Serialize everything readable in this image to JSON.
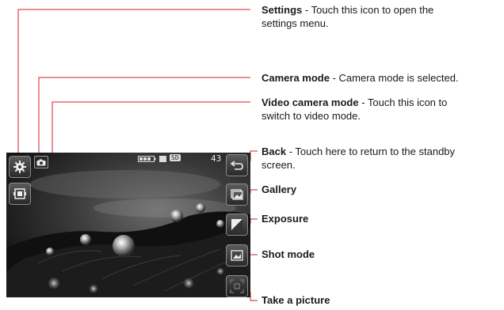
{
  "annotations": {
    "settings": {
      "title": "Settings",
      "desc": "Touch this icon to open the",
      "desc2": "settings menu."
    },
    "camera_mode": {
      "title": "Camera mode",
      "desc": "Camera mode is selected."
    },
    "video_mode": {
      "title": "Video camera mode",
      "desc": "Touch this icon to",
      "desc2": "switch to video mode."
    },
    "back": {
      "title": "Back",
      "desc": "Touch here to return to the standby",
      "desc2": "screen."
    },
    "gallery": {
      "title": "Gallery"
    },
    "exposure": {
      "title": "Exposure"
    },
    "shot_mode": {
      "title": "Shot mode"
    },
    "take_picture": {
      "title": "Take a picture"
    }
  },
  "separator": " - ",
  "screen": {
    "shot_count": "43",
    "storage_badge": "SD"
  },
  "icons": [
    "gear-icon",
    "camera-icon",
    "video-camera-icon",
    "back-arrow-icon",
    "gallery-icon",
    "exposure-icon",
    "shot-mode-icon",
    "shutter-icon"
  ],
  "colors": {
    "callout_line": "#d4212a",
    "screen_dark": "#141414"
  }
}
